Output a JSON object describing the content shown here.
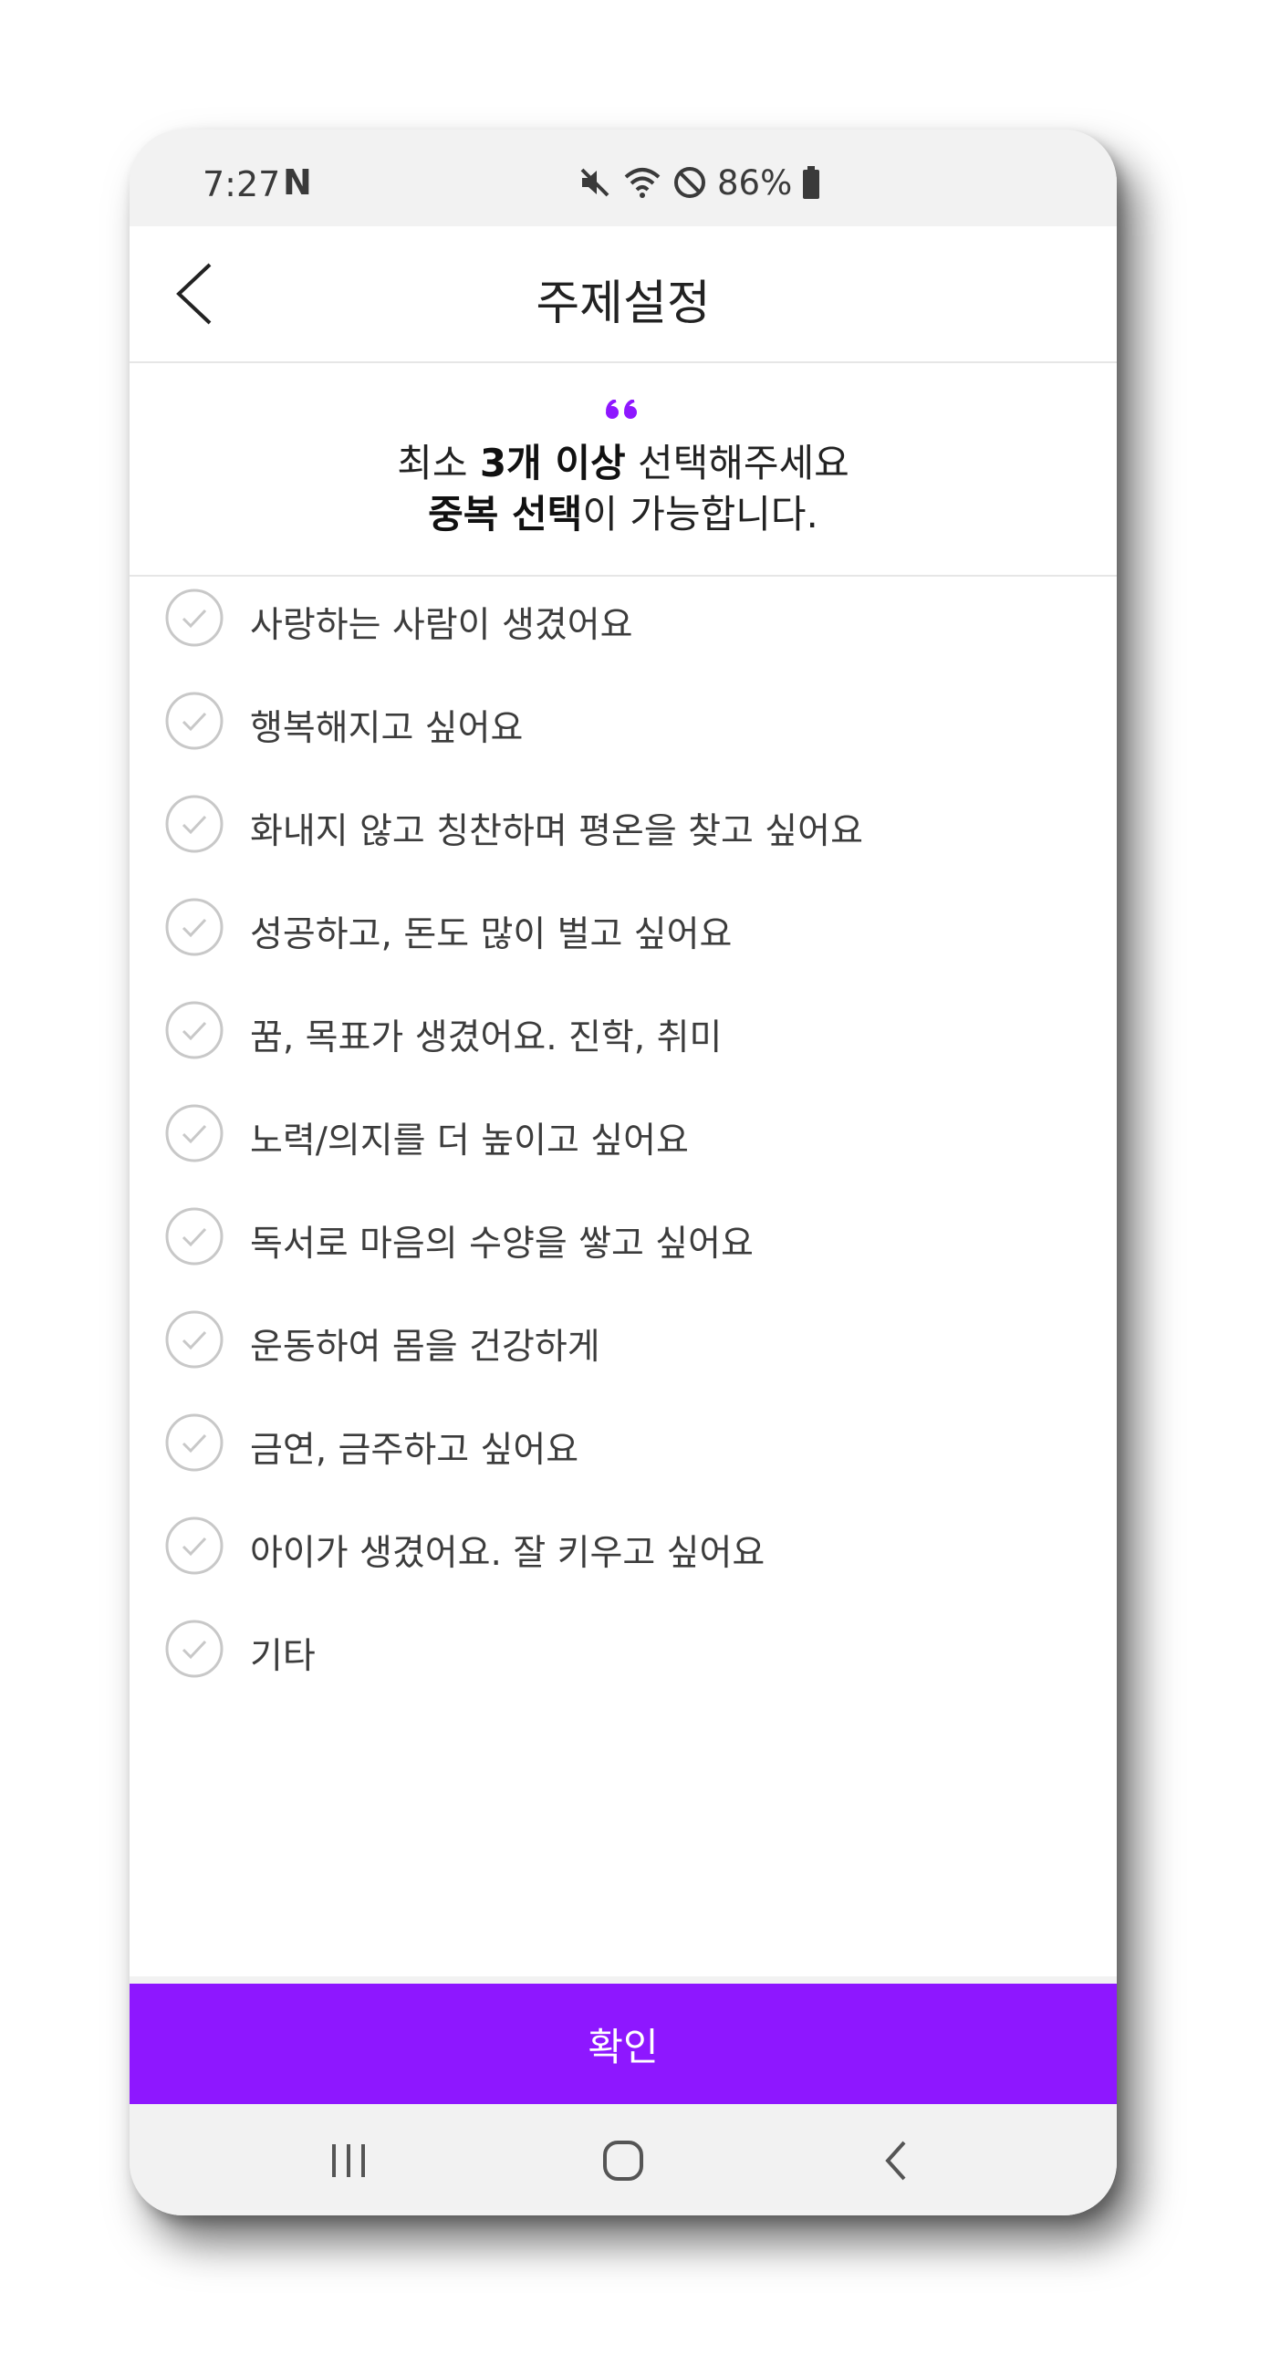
{
  "status_bar": {
    "time": "7:27",
    "app_logo": "N",
    "battery": "86%",
    "icons": [
      "mute-icon",
      "wifi-icon",
      "do-not-disturb-icon",
      "battery-icon"
    ]
  },
  "header": {
    "title": "주제설정"
  },
  "intro": {
    "line1_bold": "3개 이상",
    "line1_pre": "최소 ",
    "line1_post": " 선택해주세요",
    "line2_bold": "중복 선택",
    "line2_post": "이 가능합니다."
  },
  "topics": [
    {
      "label": "사랑하는 사람이 생겼어요",
      "selected": false
    },
    {
      "label": "행복해지고 싶어요",
      "selected": false
    },
    {
      "label": "화내지 않고 칭찬하며 평온을 찾고 싶어요",
      "selected": false
    },
    {
      "label": "성공하고, 돈도 많이 벌고 싶어요",
      "selected": false
    },
    {
      "label": "꿈, 목표가 생겼어요. 진학, 취미",
      "selected": false
    },
    {
      "label": "노력/의지를 더 높이고 싶어요",
      "selected": false
    },
    {
      "label": "독서로 마음의 수양을 쌓고 싶어요",
      "selected": false
    },
    {
      "label": "운동하여 몸을 건강하게",
      "selected": false
    },
    {
      "label": "금연, 금주하고 싶어요",
      "selected": false
    },
    {
      "label": "아이가 생겼어요. 잘 키우고 싶어요",
      "selected": false
    },
    {
      "label": "기타",
      "selected": false
    }
  ],
  "confirm_label": "확인",
  "colors": {
    "accent": "#8e17ff",
    "check_gray": "#c8c8c8"
  }
}
